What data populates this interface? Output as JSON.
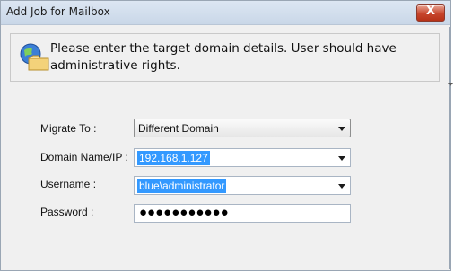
{
  "window": {
    "title": "Add Job for Mailbox",
    "close_glyph": "X"
  },
  "info": {
    "message": "Please enter the target domain details. User should have administrative rights.",
    "icon": "globe-folder-icon"
  },
  "form": {
    "migrate_to": {
      "label": "Migrate To :",
      "value": "Different Domain"
    },
    "domain": {
      "label": "Domain Name/IP :",
      "value": "192.168.1.127"
    },
    "username": {
      "label": "Username :",
      "value": "blue\\administrator"
    },
    "password": {
      "label": "Password :",
      "masked": "●●●●●●●●●●●"
    }
  },
  "colors": {
    "selection": "#3399ff",
    "close_button": "#c7452c",
    "window_bg": "#f0f0f0"
  }
}
